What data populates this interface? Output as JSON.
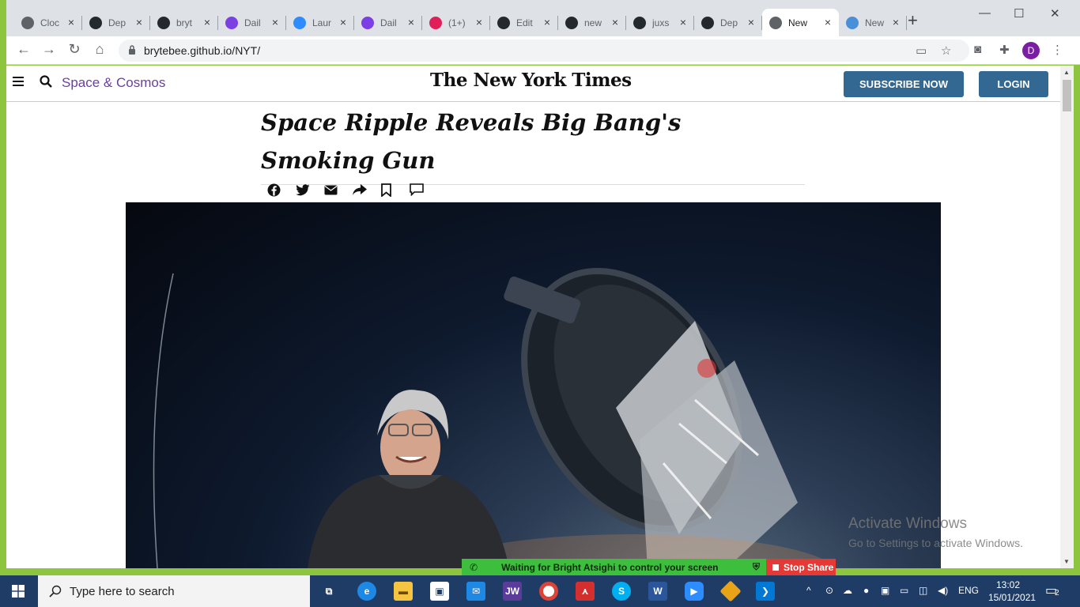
{
  "browser": {
    "tabs": [
      {
        "title": "Cloc",
        "icon": "clockify-icon",
        "color": "#5f6368",
        "active": false
      },
      {
        "title": "Dep",
        "icon": "github-icon",
        "color": "#24292e",
        "active": false
      },
      {
        "title": "bryt",
        "icon": "github-icon",
        "color": "#24292e",
        "active": false
      },
      {
        "title": "Dail",
        "icon": "daily-icon",
        "color": "#7b3fe4",
        "active": false
      },
      {
        "title": "Laur",
        "icon": "zoom-icon",
        "color": "#2d8cff",
        "active": false
      },
      {
        "title": "Dail",
        "icon": "daily-icon",
        "color": "#7b3fe4",
        "active": false
      },
      {
        "title": "(1+)",
        "icon": "slack-icon",
        "color": "#e01e5a",
        "active": false
      },
      {
        "title": "Edit",
        "icon": "github-icon",
        "color": "#24292e",
        "active": false
      },
      {
        "title": "new",
        "icon": "github-icon",
        "color": "#24292e",
        "active": false
      },
      {
        "title": "juxs",
        "icon": "github-icon",
        "color": "#24292e",
        "active": false
      },
      {
        "title": "Dep",
        "icon": "github-icon",
        "color": "#24292e",
        "active": false
      },
      {
        "title": "New",
        "icon": "globe-icon",
        "color": "#5f6368",
        "active": true
      },
      {
        "title": "New",
        "icon": "page-icon",
        "color": "#4a90d9",
        "active": false
      }
    ],
    "new_tab": "+",
    "minimize": "—",
    "maximize": "☐",
    "close": "✕",
    "url": "brytebee.github.io/NYT/",
    "profile_initial": "D"
  },
  "page": {
    "section": "Space & Cosmos",
    "masthead": "The New York Times",
    "subscribe_label": "SUBSCRIBE NOW",
    "login_label": "LOGIN",
    "headline_line1": "Space Ripple Reveals Big Bang's",
    "headline_line2": "Smoking Gun",
    "accent_color": "#326891",
    "section_color": "#6b3fa0"
  },
  "overlay": {
    "watermark_line1": "Activate Windows",
    "watermark_line2": "Go to Settings to activate Windows.",
    "share_wait": "Waiting for Bright Atsighi to control your screen",
    "share_stop": "Stop Share"
  },
  "taskbar": {
    "search_placeholder": "Type here to search",
    "language": "ENG",
    "time": "13:02",
    "date": "15/01/2021",
    "notification_count": "2"
  }
}
